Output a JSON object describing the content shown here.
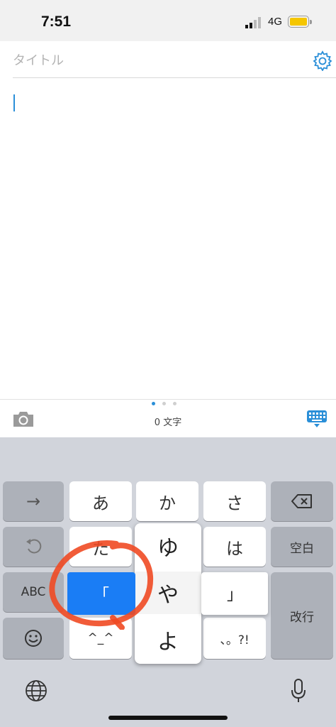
{
  "status_bar": {
    "time": "7:51",
    "network": "4G"
  },
  "editor": {
    "title_placeholder": "タイトル"
  },
  "toolbar": {
    "char_count": "0 文字"
  },
  "keyboard": {
    "left_col": {
      "arrow": "→",
      "abc": "ABC"
    },
    "row1": [
      "あ",
      "か",
      "さ"
    ],
    "row2": [
      "た",
      "は"
    ],
    "row3_left": "「",
    "row3_right": "」",
    "row4": [
      "^_^",
      "、。?!"
    ],
    "popup": [
      "ゆ",
      "や",
      "よ"
    ],
    "right_col": {
      "space": "空白",
      "return": "改行"
    }
  },
  "colors": {
    "accent": "#2a8fd8",
    "key_highlight": "#1a7df5",
    "annotation": "#f04a23",
    "keyboard_bg": "#d1d4db"
  }
}
